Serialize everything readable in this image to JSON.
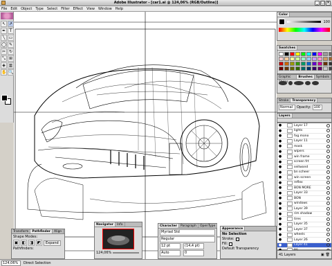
{
  "window": {
    "title": "Adobe Illustrator - [car1.ai @ 124,06% (RGB/Outline)]"
  },
  "menu": [
    "File",
    "Edit",
    "Object",
    "Type",
    "Select",
    "Filter",
    "Effect",
    "View",
    "Window",
    "Help"
  ],
  "tools": [
    "↖",
    "↗",
    "✒",
    "T",
    "╲",
    "▭",
    "◯",
    "✎",
    "✂",
    "↻",
    "⤡",
    "⊞",
    "◈",
    "▥",
    "✋",
    "🔍"
  ],
  "color_panel": {
    "tab": "Color",
    "value": "100"
  },
  "swatches_panel": {
    "tab": "Swatches",
    "colors": [
      "#ffffff",
      "#000000",
      "#ff0000",
      "#ffff00",
      "#00ff00",
      "#00ffff",
      "#0000ff",
      "#ff00ff",
      "#999999",
      "#666666",
      "#ffcccc",
      "#ffcc99",
      "#ffff99",
      "#ccff99",
      "#99ffcc",
      "#99ccff",
      "#cc99ff",
      "#ff99cc",
      "#cc9966",
      "#996633",
      "#cc0000",
      "#cc6600",
      "#999900",
      "#339900",
      "#009966",
      "#0066cc",
      "#6600cc",
      "#cc0099",
      "#663300",
      "#333333",
      "#660000",
      "#663300",
      "#666600",
      "#336600",
      "#006666",
      "#003366",
      "#330066",
      "#660066",
      "#cccccc",
      "#444444"
    ]
  },
  "graphic_styles": {
    "tabs": [
      "Graphic Styles",
      "Brushes",
      "Symbols"
    ]
  },
  "transparency": {
    "tabs": [
      "Stroke",
      "Transparency"
    ],
    "mode": "Normal",
    "opacity_label": "Opacity:",
    "opacity": "100"
  },
  "layers_panel": {
    "tab": "Layers",
    "items": [
      "Layer 17",
      "lights",
      "fog mono",
      "Layer 11",
      "mask",
      "wipers",
      "win frame",
      "screen frt",
      "seitwand",
      "bn scheer",
      "win screen",
      "reflex",
      "BON MORE",
      "Layer 33",
      "BON",
      "windows",
      "Layer 39",
      "rim shadow",
      "tires",
      "Layer 35",
      "Layer 37",
      "wheels",
      "Layer 26",
      "Layer 41",
      "RS",
      "Layer 1"
    ],
    "selected": "Layer 41",
    "footer": "41 Layers"
  },
  "transform_panel": {
    "tabs": [
      "Transform",
      "Pathfinder",
      "Align"
    ],
    "labels": [
      "Shape Modes:",
      "Pathfinders:"
    ],
    "expand": "Expand"
  },
  "navigator_panel": {
    "tabs": [
      "Navigator",
      "Info"
    ],
    "zoom": "124,06%"
  },
  "character_panel": {
    "tabs": [
      "Character",
      "Paragraph",
      "OpenType"
    ],
    "font": "Myriad Std",
    "style": "Regular",
    "size": "12 pt",
    "leading": "(14,4 pt)",
    "tracking": "Auto",
    "kerning": "0"
  },
  "appearance_panel": {
    "tab": "Appearance",
    "title": "No Selection",
    "rows": [
      "Stroke:",
      "Fill:",
      "Default Transparency"
    ]
  },
  "status": {
    "zoom": "124,06%",
    "mode": "Direct Selection"
  }
}
